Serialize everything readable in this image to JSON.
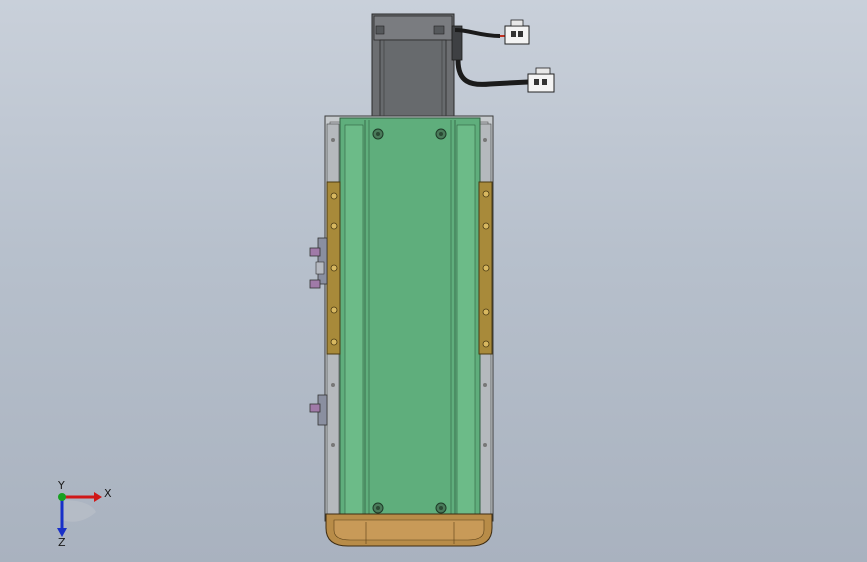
{
  "app": {
    "view": "front",
    "colors": {
      "background_top": "#c9d0da",
      "background_bottom": "#a9b2bf",
      "carriage_green": "#5fae7c",
      "rail_brass": "#a88a3a",
      "motor_gray": "#6d6f72",
      "frame_silver": "#c4c8cc",
      "end_cap_tan": "#b88c48"
    }
  },
  "triad": {
    "x_label": "X",
    "y_label": "Y",
    "z_label": "Z",
    "x_color": "#d01818",
    "y_color": "#18a020",
    "z_color": "#1830c8"
  },
  "icons": [
    "motor-icon",
    "connector-icon",
    "axis-triad-icon"
  ]
}
